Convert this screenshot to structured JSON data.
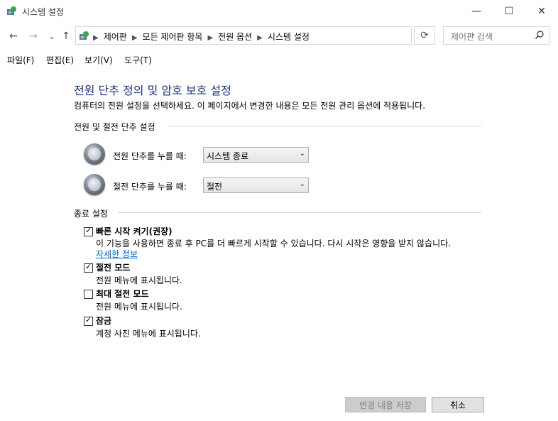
{
  "window": {
    "title": "시스템 설정",
    "minimize": "—",
    "maximize": "☐",
    "close": "✕"
  },
  "nav": {
    "back": "←",
    "forward": "→",
    "recent": "⌄",
    "up": "↑",
    "breadcrumb": [
      "제어판",
      "모든 제어판 항목",
      "전원 옵션",
      "시스템 설정"
    ],
    "search_placeholder": "제어판 검색",
    "refresh": "⟳"
  },
  "menu": [
    "파일(F)",
    "편집(E)",
    "보기(V)",
    "도구(T)"
  ],
  "main": {
    "heading": "전원 단추 정의 및 암호 보호 설정",
    "description": "컴퓨터의 전원 설정을 선택하세요. 이 페이지에서 변경한 내용은 모든 전원 관리 옵션에 적용됩니다.",
    "power_section": "전원 및 절전 단추 설정",
    "power_button_label": "전원 단추를 누를 때:",
    "power_button_value": "시스템 종료",
    "sleep_button_label": "절전 단추를 누를 때:",
    "sleep_button_value": "절전",
    "shutdown_section": "종료 설정",
    "options": [
      {
        "label": "빠른 시작 켜기(권장)",
        "checked": true,
        "desc": "이 기능을 사용하면 종료 후 PC를 더 빠르게 시작할 수 있습니다. 다시 시작은 영향을 받지 않습니다.",
        "link": "자세한 정보"
      },
      {
        "label": "절전 모드",
        "checked": true,
        "desc": "전원 메뉴에 표시됩니다."
      },
      {
        "label": "최대 절전 모드",
        "checked": false,
        "desc": "전원 메뉴에 표시됩니다."
      },
      {
        "label": "잠금",
        "checked": true,
        "desc": "계정 사진 메뉴에 표시됩니다."
      }
    ]
  },
  "footer": {
    "save": "변경 내용 저장",
    "cancel": "취소"
  }
}
